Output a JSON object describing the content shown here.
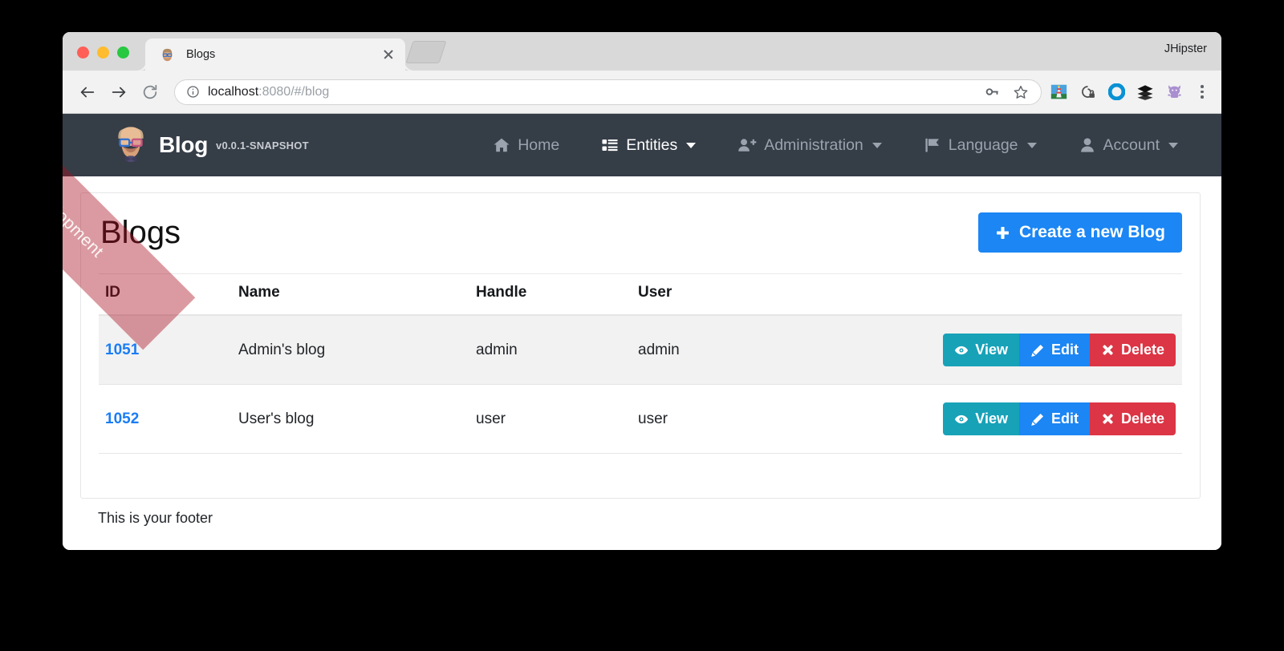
{
  "browser": {
    "profile_name": "JHipster",
    "tab": {
      "title": "Blogs",
      "favicon": "jhipster-avatar-icon",
      "close": "close-icon"
    },
    "toolbar": {
      "back": "back-arrow-icon",
      "forward": "forward-arrow-icon",
      "reload": "reload-icon",
      "info": "info-circle-icon",
      "url_host": "localhost",
      "url_rest": ":8080/#/blog",
      "url_full": "localhost:8080/#/blog",
      "key_icon": "password-key-icon",
      "star_icon": "bookmark-star-icon",
      "menu_icon": "three-dots-menu-icon",
      "extensions": [
        {
          "name": "lighthouse-extension-icon"
        },
        {
          "name": "privacy-lock-extension-icon"
        },
        {
          "name": "blue-circle-extension-icon"
        },
        {
          "name": "layers-extension-icon"
        },
        {
          "name": "octotree-cat-extension-icon"
        }
      ]
    }
  },
  "ribbon": {
    "label": "Development",
    "color": "#aa0f1e"
  },
  "navbar": {
    "logo": "jhipster-avatar-logo",
    "brand": "Blog",
    "version": "v0.0.1-SNAPSHOT",
    "background": "#353d47",
    "items": [
      {
        "label": "Home",
        "icon": "home-icon",
        "caret": false,
        "active": false
      },
      {
        "label": "Entities",
        "icon": "list-icon",
        "caret": true,
        "active": true
      },
      {
        "label": "Administration",
        "icon": "user-plus-icon",
        "caret": true,
        "active": false
      },
      {
        "label": "Language",
        "icon": "flag-icon",
        "caret": true,
        "active": false
      },
      {
        "label": "Account",
        "icon": "user-icon",
        "caret": true,
        "active": false
      }
    ]
  },
  "main": {
    "page_title": "Blogs",
    "create_button": {
      "label": "Create a new Blog",
      "icon": "plus-icon",
      "color": "#1b86f4"
    },
    "table": {
      "columns": [
        "ID",
        "Name",
        "Handle",
        "User"
      ],
      "rows": [
        {
          "id": "1051",
          "name": "Admin's blog",
          "handle": "admin",
          "user": "admin",
          "highlighted": true
        },
        {
          "id": "1052",
          "name": "User's blog",
          "handle": "user",
          "user": "user",
          "highlighted": false
        }
      ],
      "actions": [
        {
          "label": "View",
          "icon": "eye-icon",
          "color": "#17a2b8"
        },
        {
          "label": "Edit",
          "icon": "pencil-icon",
          "color": "#1b86f4"
        },
        {
          "label": "Delete",
          "icon": "times-icon",
          "color": "#dc3545"
        }
      ]
    }
  },
  "footer": {
    "text": "This is your footer"
  }
}
